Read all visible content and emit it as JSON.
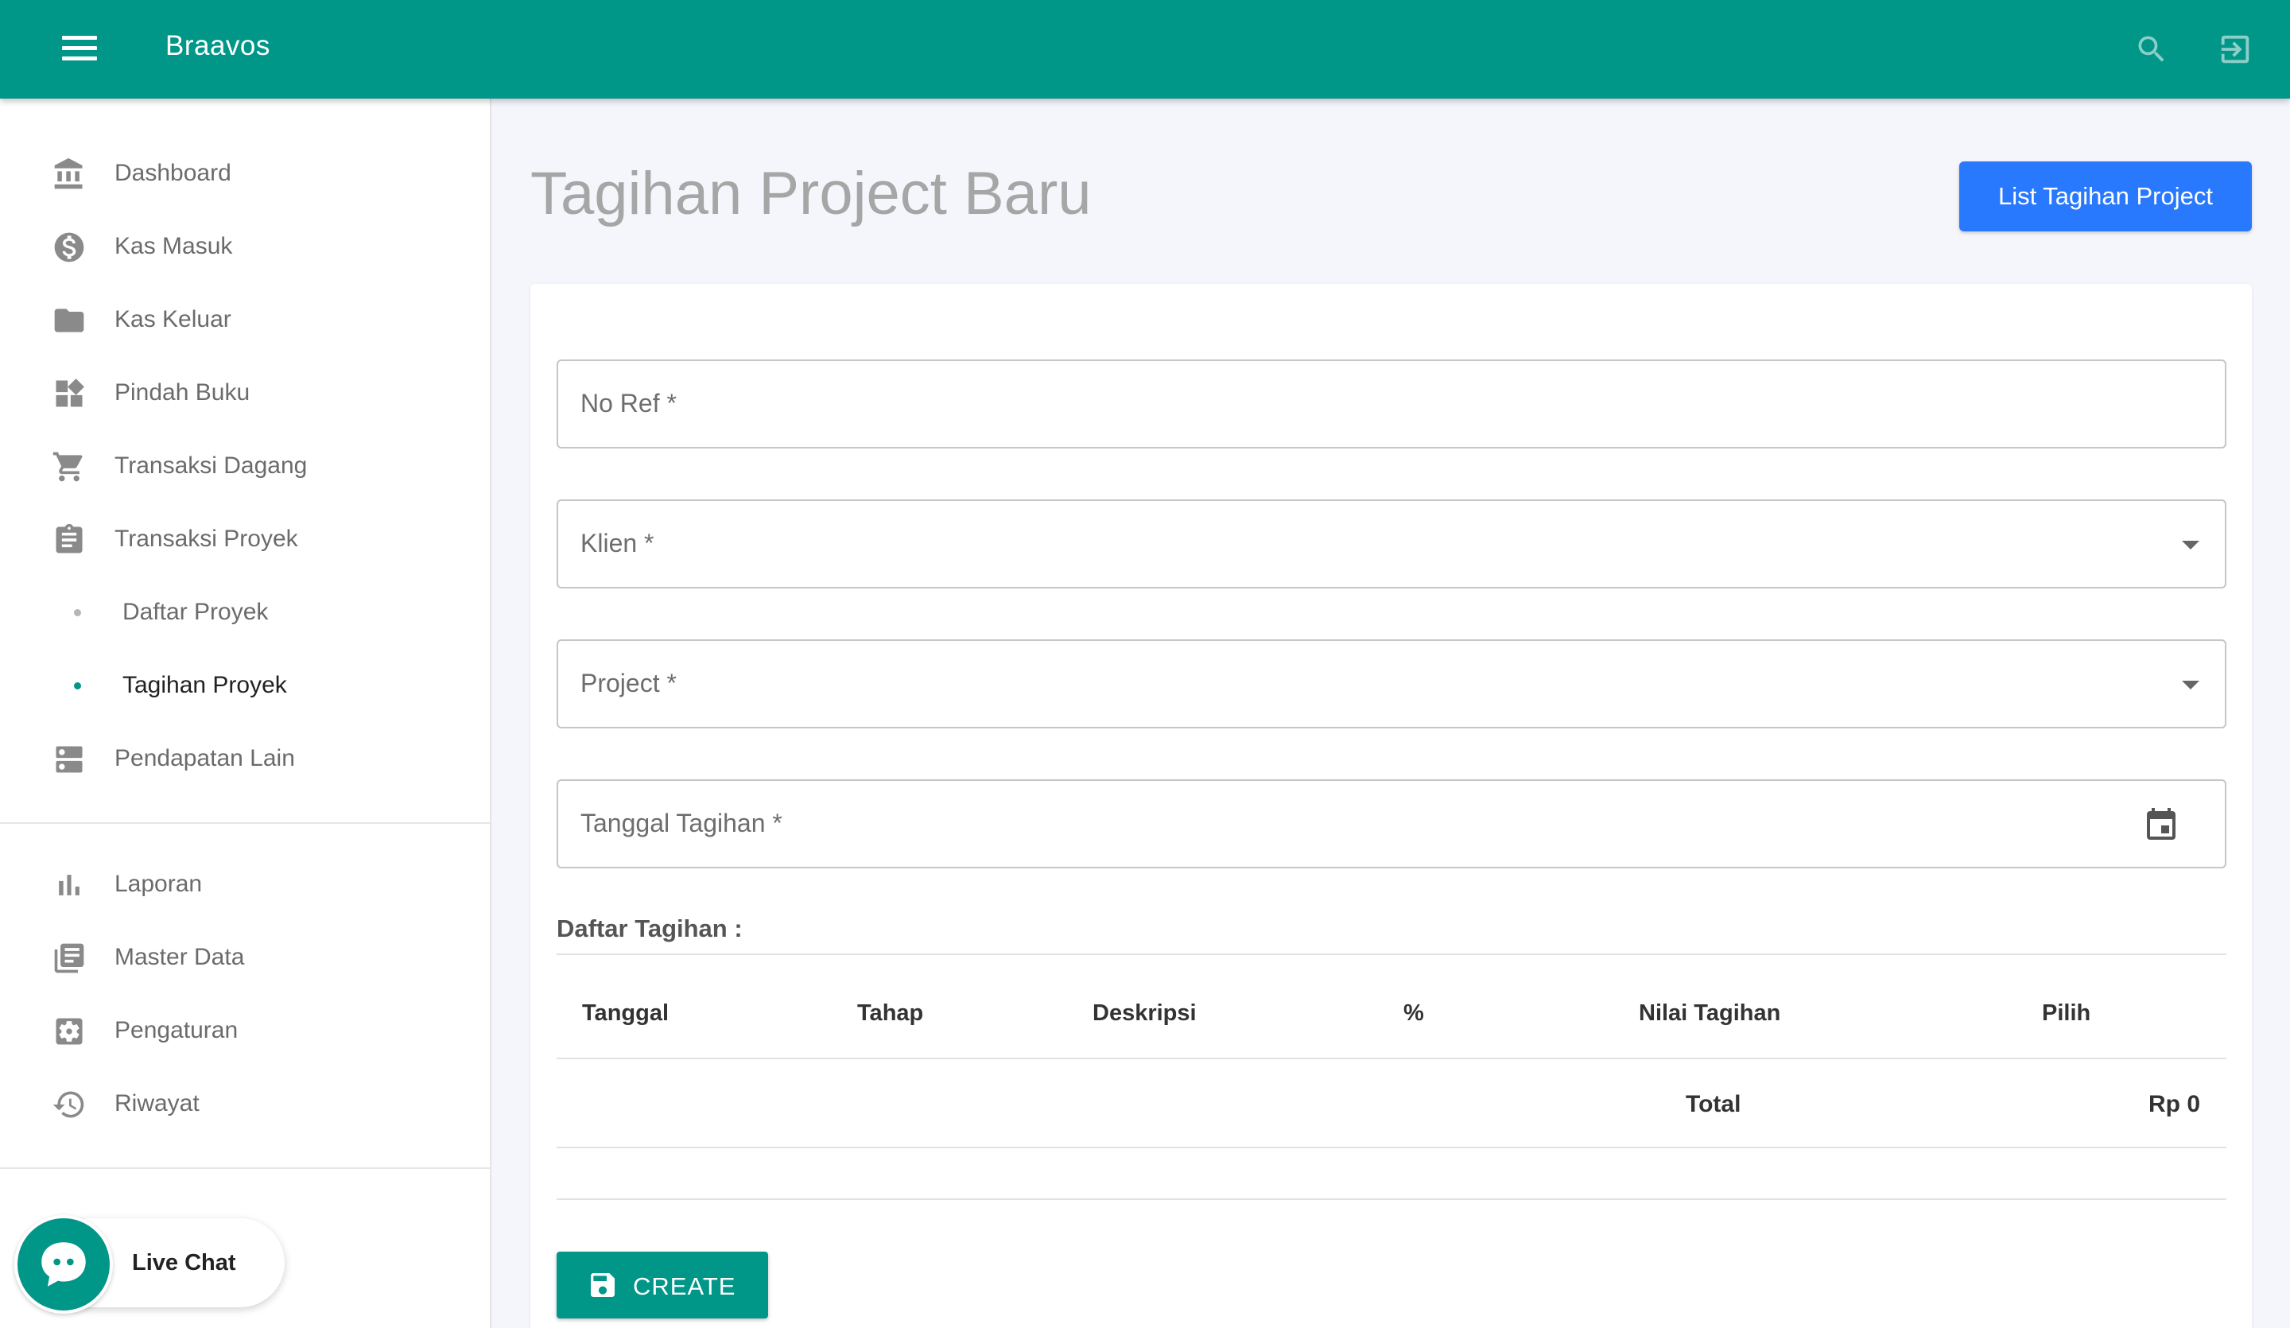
{
  "app": {
    "brand": "Braavos"
  },
  "colors": {
    "primary": "#009688",
    "accent": "#2979ff"
  },
  "topbar": {
    "menu_icon": "hamburger-menu-icon",
    "search_icon": "search-icon",
    "logout_icon": "logout-icon"
  },
  "sidebar": {
    "items": [
      {
        "label": "Dashboard",
        "icon": "bank-icon"
      },
      {
        "label": "Kas Masuk",
        "icon": "dollar-circle-icon"
      },
      {
        "label": "Kas Keluar",
        "icon": "folder-icon"
      },
      {
        "label": "Pindah Buku",
        "icon": "widgets-icon"
      },
      {
        "label": "Transaksi Dagang",
        "icon": "cart-icon"
      },
      {
        "label": "Transaksi Proyek",
        "icon": "clipboard-icon"
      },
      {
        "label": "Daftar Proyek",
        "icon": "dot"
      },
      {
        "label": "Tagihan Proyek",
        "icon": "dot",
        "active": true
      },
      {
        "label": "Pendapatan Lain",
        "icon": "inbox-icon"
      },
      {
        "label": "Laporan",
        "icon": "bar-chart-icon"
      },
      {
        "label": "Master Data",
        "icon": "library-icon"
      },
      {
        "label": "Pengaturan",
        "icon": "settings-icon"
      },
      {
        "label": "Riwayat",
        "icon": "history-icon"
      }
    ]
  },
  "livechat": {
    "label": "Live Chat"
  },
  "page": {
    "title": "Tagihan Project Baru",
    "list_button": "List Tagihan Project"
  },
  "form": {
    "no_ref": "No Ref *",
    "klien": "Klien *",
    "project": "Project *",
    "tanggal": "Tanggal Tagihan *"
  },
  "table": {
    "section_title": "Daftar Tagihan :",
    "headers": [
      "Tanggal",
      "Tahap",
      "Deskripsi",
      "%",
      "Nilai Tagihan",
      "Pilih"
    ],
    "total_label": "Total",
    "total_value": "Rp 0"
  },
  "create_button": "CREATE"
}
